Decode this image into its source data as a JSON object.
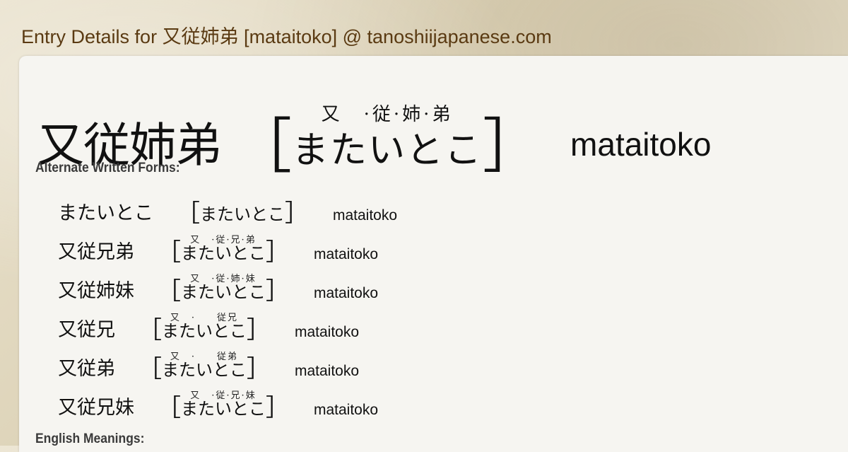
{
  "page": {
    "title": "Entry Details for 又従姉弟 [mataitoko] @ tanoshiijapanese.com"
  },
  "entry": {
    "word": "又従姉弟",
    "ruby": "又　·従·姉·弟",
    "reading": "またいとこ",
    "romaji": "mataitoko",
    "bracket_open": "［",
    "bracket_close": "］"
  },
  "sections": {
    "alternate_label": "Alternate Written Forms:",
    "english_label": "English Meanings:"
  },
  "alternates": [
    {
      "word": "またいとこ",
      "ruby": "",
      "reading": "またいとこ",
      "romaji": "mataitoko"
    },
    {
      "word": "又従兄弟",
      "ruby": "又　·従·兄·弟",
      "reading": "またいとこ",
      "romaji": "mataitoko"
    },
    {
      "word": "又従姉妹",
      "ruby": "又　·従·姉·妹",
      "reading": "またいとこ",
      "romaji": "mataitoko"
    },
    {
      "word": "又従兄",
      "ruby": "又　·　　従兄",
      "reading": "またいとこ",
      "romaji": "mataitoko"
    },
    {
      "word": "又従弟",
      "ruby": "又　·　　従弟",
      "reading": "またいとこ",
      "romaji": "mataitoko"
    },
    {
      "word": "又従兄妹",
      "ruby": "又　·従·兄·妹",
      "reading": "またいとこ",
      "romaji": "mataitoko"
    }
  ],
  "colors": {
    "title": "#5a3a12",
    "card_background": "#f6f5f1",
    "page_background": "#e6dec9"
  }
}
